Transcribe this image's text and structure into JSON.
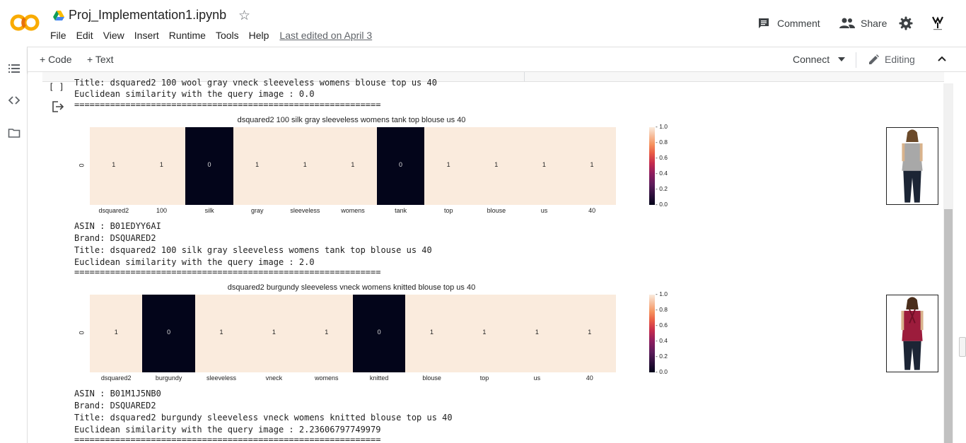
{
  "app": {
    "notebook_title": "Proj_Implementation1.ipynb",
    "menu": [
      "File",
      "Edit",
      "View",
      "Insert",
      "Runtime",
      "Tools",
      "Help"
    ],
    "last_edited": "Last edited on April 3",
    "comment_label": "Comment",
    "share_label": "Share",
    "colors": {
      "logo_orange": "#F9AB00",
      "logo_dark": "#E8710A",
      "accent": "#1a73e8"
    }
  },
  "toolbar": {
    "add_code": "+ Code",
    "add_text": "+ Text",
    "connect_label": "Connect",
    "editing_label": "Editing"
  },
  "cell": {
    "run_bracket": "[ ]",
    "clipped_line": "Title: dsquared2 100 wool gray vneck sleeveless womens blouse top us 40",
    "lines_top": [
      "Euclidean similarity with the query image : 0.0",
      "============================================================"
    ]
  },
  "results": [
    {
      "chart_data": {
        "type": "heatmap",
        "title": "dsquared2 100 silk gray sleeveless womens tank top blouse us 40",
        "x_tick_labels": [
          "dsquared2",
          "100",
          "silk",
          "gray",
          "sleeveless",
          "womens",
          "tank",
          "top",
          "blouse",
          "us",
          "40"
        ],
        "y_tick_labels": [
          "0"
        ],
        "values": [
          [
            1,
            1,
            0,
            1,
            1,
            1,
            0,
            1,
            1,
            1,
            1
          ]
        ],
        "colorbar_ticks": [
          "1.0",
          "0.8",
          "0.6",
          "0.4",
          "0.2",
          "0.0"
        ],
        "colormap": "rocket",
        "vmin": 0.0,
        "vmax": 1.0
      },
      "image": "gray-sleeveless-tank-top-photo",
      "asin": "ASIN : B01EDYY6AI",
      "brand": "Brand: DSQUARED2",
      "title": "Title: dsquared2 100 silk gray sleeveless womens tank top blouse us 40",
      "similarity": "Euclidean similarity with the query image : 2.0",
      "separator": "============================================================"
    },
    {
      "chart_data": {
        "type": "heatmap",
        "title": "dsquared2 burgundy sleeveless vneck womens knitted blouse top us 40",
        "x_tick_labels": [
          "dsquared2",
          "burgundy",
          "sleeveless",
          "vneck",
          "womens",
          "knitted",
          "blouse",
          "top",
          "us",
          "40"
        ],
        "y_tick_labels": [
          "0"
        ],
        "values": [
          [
            1,
            0,
            1,
            1,
            1,
            0,
            1,
            1,
            1,
            1
          ]
        ],
        "colorbar_ticks": [
          "1.0",
          "0.8",
          "0.6",
          "0.4",
          "0.2",
          "0.0"
        ],
        "colormap": "rocket",
        "vmin": 0.0,
        "vmax": 1.0
      },
      "image": "burgundy-tie-neck-top-photo",
      "asin": "ASIN : B01M1J5NB0",
      "brand": "Brand: DSQUARED2",
      "title": "Title: dsquared2 burgundy sleeveless vneck womens knitted blouse top us 40",
      "similarity": "Euclidean similarity with the query image : 2.23606797749979",
      "separator": "============================================================"
    }
  ]
}
